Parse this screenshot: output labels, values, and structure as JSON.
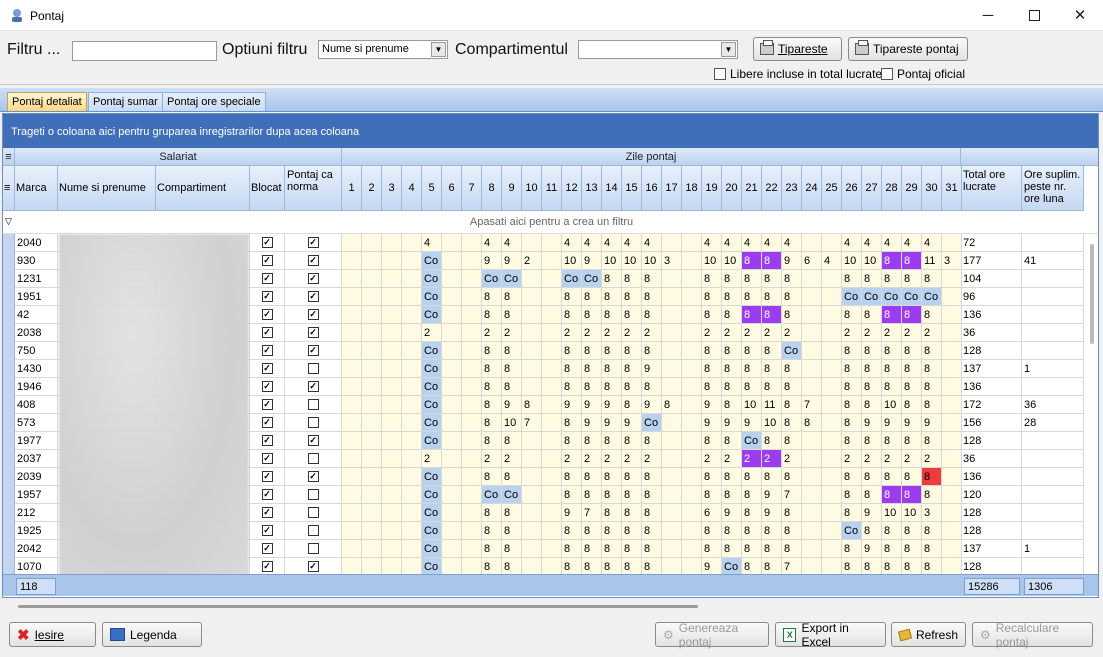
{
  "window": {
    "title": "Pontaj"
  },
  "toolbar": {
    "filter_label": "Filtru ...",
    "filter_options_label": "Optiuni filtru",
    "filter_options_value": "Nume si prenume",
    "department_label": "Compartimentul",
    "department_value": "",
    "print_button": "Tipareste",
    "print_timesheet_button": "Tipareste pontaj",
    "free_included_label": "Libere incluse in total lucrate",
    "official_label": "Pontaj oficial"
  },
  "tabs": [
    "Pontaj detaliat",
    "Pontaj sumar",
    "Pontaj ore speciale"
  ],
  "grid": {
    "group_hint": "Trageti o coloana aici pentru gruparea inregistrarilor dupa acea coloana",
    "band_employee": "Salariat",
    "band_days": "Zile pontaj",
    "col_marca": "Marca",
    "col_name": "Nume si prenume",
    "col_department": "Compartiment",
    "col_blocked": "Blocat",
    "col_norm": "Pontaj ca norma",
    "col_total": "Total ore lucrate",
    "col_overtime": "Ore suplim. peste nr. ore luna",
    "filter_hint": "Apasati aici pentru a crea un filtru",
    "day_numbers": [
      "1",
      "2",
      "3",
      "4",
      "5",
      "6",
      "7",
      "8",
      "9",
      "10",
      "11",
      "12",
      "13",
      "14",
      "15",
      "16",
      "17",
      "18",
      "19",
      "20",
      "21",
      "22",
      "23",
      "24",
      "25",
      "26",
      "27",
      "28",
      "29",
      "30",
      "31"
    ],
    "rows": [
      {
        "marca": "2040",
        "blocat": true,
        "norma": true,
        "days": [
          "",
          "",
          "",
          "",
          "4",
          "",
          "",
          "4",
          "4",
          "",
          "",
          "4",
          "4",
          "4",
          "4",
          "4",
          "",
          "",
          "4",
          "4",
          "4",
          "4",
          "4",
          "",
          "",
          "4",
          "4",
          "4",
          "4",
          "4",
          ""
        ],
        "total": "72",
        "over": ""
      },
      {
        "marca": "930",
        "blocat": true,
        "norma": true,
        "days": [
          "",
          "",
          "",
          "",
          "Co",
          "",
          "",
          "9",
          "9",
          "2",
          "",
          "10",
          "9",
          "10",
          "10",
          "10",
          "3",
          "",
          "10",
          "10",
          "8",
          "8",
          "9",
          "6",
          "4",
          "10",
          "10",
          "8",
          "8",
          "11",
          "3"
        ],
        "total": "177",
        "over": "41"
      },
      {
        "marca": "1231",
        "blocat": true,
        "norma": true,
        "days": [
          "",
          "",
          "",
          "",
          "Co",
          "",
          "",
          "Co",
          "Co",
          "",
          "",
          "Co",
          "Co",
          "8",
          "8",
          "8",
          "",
          "",
          "8",
          "8",
          "8",
          "8",
          "8",
          "",
          "",
          "8",
          "8",
          "8",
          "8",
          "8",
          ""
        ],
        "total": "104",
        "over": ""
      },
      {
        "marca": "1951",
        "blocat": true,
        "norma": true,
        "days": [
          "",
          "",
          "",
          "",
          "Co",
          "",
          "",
          "8",
          "8",
          "",
          "",
          "8",
          "8",
          "8",
          "8",
          "8",
          "",
          "",
          "8",
          "8",
          "8",
          "8",
          "8",
          "",
          "",
          "Co",
          "Co",
          "Co",
          "Co",
          "Co",
          ""
        ],
        "total": "96",
        "over": ""
      },
      {
        "marca": "42",
        "blocat": true,
        "norma": true,
        "days": [
          "",
          "",
          "",
          "",
          "Co",
          "",
          "",
          "8",
          "8",
          "",
          "",
          "8",
          "8",
          "8",
          "8",
          "8",
          "",
          "",
          "8",
          "8",
          "8",
          "8",
          "8",
          "",
          "",
          "8",
          "8",
          "8",
          "8",
          "8",
          ""
        ],
        "total": "136",
        "over": ""
      },
      {
        "marca": "2038",
        "blocat": true,
        "norma": true,
        "days": [
          "",
          "",
          "",
          "",
          "2",
          "",
          "",
          "2",
          "2",
          "",
          "",
          "2",
          "2",
          "2",
          "2",
          "2",
          "",
          "",
          "2",
          "2",
          "2",
          "2",
          "2",
          "",
          "",
          "2",
          "2",
          "2",
          "2",
          "2",
          ""
        ],
        "total": "36",
        "over": ""
      },
      {
        "marca": "750",
        "blocat": true,
        "norma": true,
        "days": [
          "",
          "",
          "",
          "",
          "Co",
          "",
          "",
          "8",
          "8",
          "",
          "",
          "8",
          "8",
          "8",
          "8",
          "8",
          "",
          "",
          "8",
          "8",
          "8",
          "8",
          "Co",
          "",
          "",
          "8",
          "8",
          "8",
          "8",
          "8",
          ""
        ],
        "total": "128",
        "over": ""
      },
      {
        "marca": "1430",
        "blocat": true,
        "norma": false,
        "days": [
          "",
          "",
          "",
          "",
          "Co",
          "",
          "",
          "8",
          "8",
          "",
          "",
          "8",
          "8",
          "8",
          "8",
          "9",
          "",
          "",
          "8",
          "8",
          "8",
          "8",
          "8",
          "",
          "",
          "8",
          "8",
          "8",
          "8",
          "8",
          ""
        ],
        "total": "137",
        "over": "1"
      },
      {
        "marca": "1946",
        "blocat": true,
        "norma": true,
        "days": [
          "",
          "",
          "",
          "",
          "Co",
          "",
          "",
          "8",
          "8",
          "",
          "",
          "8",
          "8",
          "8",
          "8",
          "8",
          "",
          "",
          "8",
          "8",
          "8",
          "8",
          "8",
          "",
          "",
          "8",
          "8",
          "8",
          "8",
          "8",
          ""
        ],
        "total": "136",
        "over": ""
      },
      {
        "marca": "408",
        "blocat": true,
        "norma": false,
        "days": [
          "",
          "",
          "",
          "",
          "Co",
          "",
          "",
          "8",
          "9",
          "8",
          "",
          "9",
          "9",
          "9",
          "8",
          "9",
          "8",
          "",
          "9",
          "8",
          "10",
          "11",
          "8",
          "7",
          "",
          "8",
          "8",
          "10",
          "8",
          "8",
          ""
        ],
        "total": "172",
        "over": "36"
      },
      {
        "marca": "573",
        "blocat": true,
        "norma": false,
        "days": [
          "",
          "",
          "",
          "",
          "Co",
          "",
          "",
          "8",
          "10",
          "7",
          "",
          "8",
          "9",
          "9",
          "9",
          "Co",
          "",
          "",
          "9",
          "9",
          "9",
          "10",
          "8",
          "8",
          "",
          "8",
          "9",
          "9",
          "9",
          "9",
          ""
        ],
        "total": "156",
        "over": "28"
      },
      {
        "marca": "1977",
        "blocat": true,
        "norma": true,
        "days": [
          "",
          "",
          "",
          "",
          "Co",
          "",
          "",
          "8",
          "8",
          "",
          "",
          "8",
          "8",
          "8",
          "8",
          "8",
          "",
          "",
          "8",
          "8",
          "Co",
          "8",
          "8",
          "",
          "",
          "8",
          "8",
          "8",
          "8",
          "8",
          ""
        ],
        "total": "128",
        "over": ""
      },
      {
        "marca": "2037",
        "blocat": true,
        "norma": false,
        "days": [
          "",
          "",
          "",
          "",
          "2",
          "",
          "",
          "2",
          "2",
          "",
          "",
          "2",
          "2",
          "2",
          "2",
          "2",
          "",
          "",
          "2",
          "2",
          "2",
          "2",
          "2",
          "",
          "",
          "2",
          "2",
          "2",
          "2",
          "2",
          ""
        ],
        "total": "36",
        "over": ""
      },
      {
        "marca": "2039",
        "blocat": true,
        "norma": true,
        "days": [
          "",
          "",
          "",
          "",
          "Co",
          "",
          "",
          "8",
          "8",
          "",
          "",
          "8",
          "8",
          "8",
          "8",
          "8",
          "",
          "",
          "8",
          "8",
          "8",
          "8",
          "8",
          "",
          "",
          "8",
          "8",
          "8",
          "8",
          "8",
          ""
        ],
        "total": "136",
        "over": ""
      },
      {
        "marca": "1957",
        "blocat": true,
        "norma": false,
        "days": [
          "",
          "",
          "",
          "",
          "Co",
          "",
          "",
          "Co",
          "Co",
          "",
          "",
          "8",
          "8",
          "8",
          "8",
          "8",
          "",
          "",
          "8",
          "8",
          "8",
          "9",
          "7",
          "",
          "",
          "8",
          "8",
          "8",
          "8",
          "8",
          ""
        ],
        "total": "120",
        "over": ""
      },
      {
        "marca": "212",
        "blocat": true,
        "norma": false,
        "days": [
          "",
          "",
          "",
          "",
          "Co",
          "",
          "",
          "8",
          "8",
          "",
          "",
          "9",
          "7",
          "8",
          "8",
          "8",
          "",
          "",
          "6",
          "9",
          "8",
          "9",
          "8",
          "",
          "",
          "8",
          "9",
          "10",
          "10",
          "3",
          ""
        ],
        "total": "128",
        "over": ""
      },
      {
        "marca": "1925",
        "blocat": true,
        "norma": false,
        "days": [
          "",
          "",
          "",
          "",
          "Co",
          "",
          "",
          "8",
          "8",
          "",
          "",
          "8",
          "8",
          "8",
          "8",
          "8",
          "",
          "",
          "8",
          "8",
          "8",
          "8",
          "8",
          "",
          "",
          "Co",
          "8",
          "8",
          "8",
          "8",
          ""
        ],
        "total": "128",
        "over": ""
      },
      {
        "marca": "2042",
        "blocat": true,
        "norma": false,
        "days": [
          "",
          "",
          "",
          "",
          "Co",
          "",
          "",
          "8",
          "8",
          "",
          "",
          "8",
          "8",
          "8",
          "8",
          "8",
          "",
          "",
          "8",
          "8",
          "8",
          "8",
          "8",
          "",
          "",
          "8",
          "9",
          "8",
          "8",
          "8",
          ""
        ],
        "total": "137",
        "over": "1"
      },
      {
        "marca": "1070",
        "blocat": true,
        "norma": true,
        "days": [
          "",
          "",
          "",
          "",
          "Co",
          "",
          "",
          "8",
          "8",
          "",
          "",
          "8",
          "8",
          "8",
          "8",
          "8",
          "",
          "",
          "9",
          "Co",
          "8",
          "8",
          "7",
          "",
          "",
          "8",
          "8",
          "8",
          "8",
          "8",
          ""
        ],
        "total": "128",
        "over": ""
      }
    ],
    "purple_cells": [
      [
        1,
        20
      ],
      [
        1,
        21
      ],
      [
        1,
        27
      ],
      [
        1,
        28
      ],
      [
        4,
        20
      ],
      [
        4,
        21
      ],
      [
        4,
        27
      ],
      [
        4,
        28
      ],
      [
        12,
        20
      ],
      [
        12,
        21
      ],
      [
        14,
        27
      ],
      [
        14,
        28
      ]
    ],
    "red_cells": [
      [
        13,
        29
      ]
    ],
    "footer_count": "118",
    "footer_total": "15286",
    "footer_over": "1306"
  },
  "buttons": {
    "exit": "Iesire",
    "legend": "Legenda",
    "generate": "Genereaza pontaj",
    "export": "Export in Excel",
    "refresh": "Refresh",
    "recalc": "Recalculare pontaj"
  },
  "colors": {
    "accent": "#3f6fb8",
    "day_bg": "#fffbe2",
    "co_bg": "#b7d1ee",
    "purple": "#9b3cf0",
    "red": "#ee3b3b"
  }
}
